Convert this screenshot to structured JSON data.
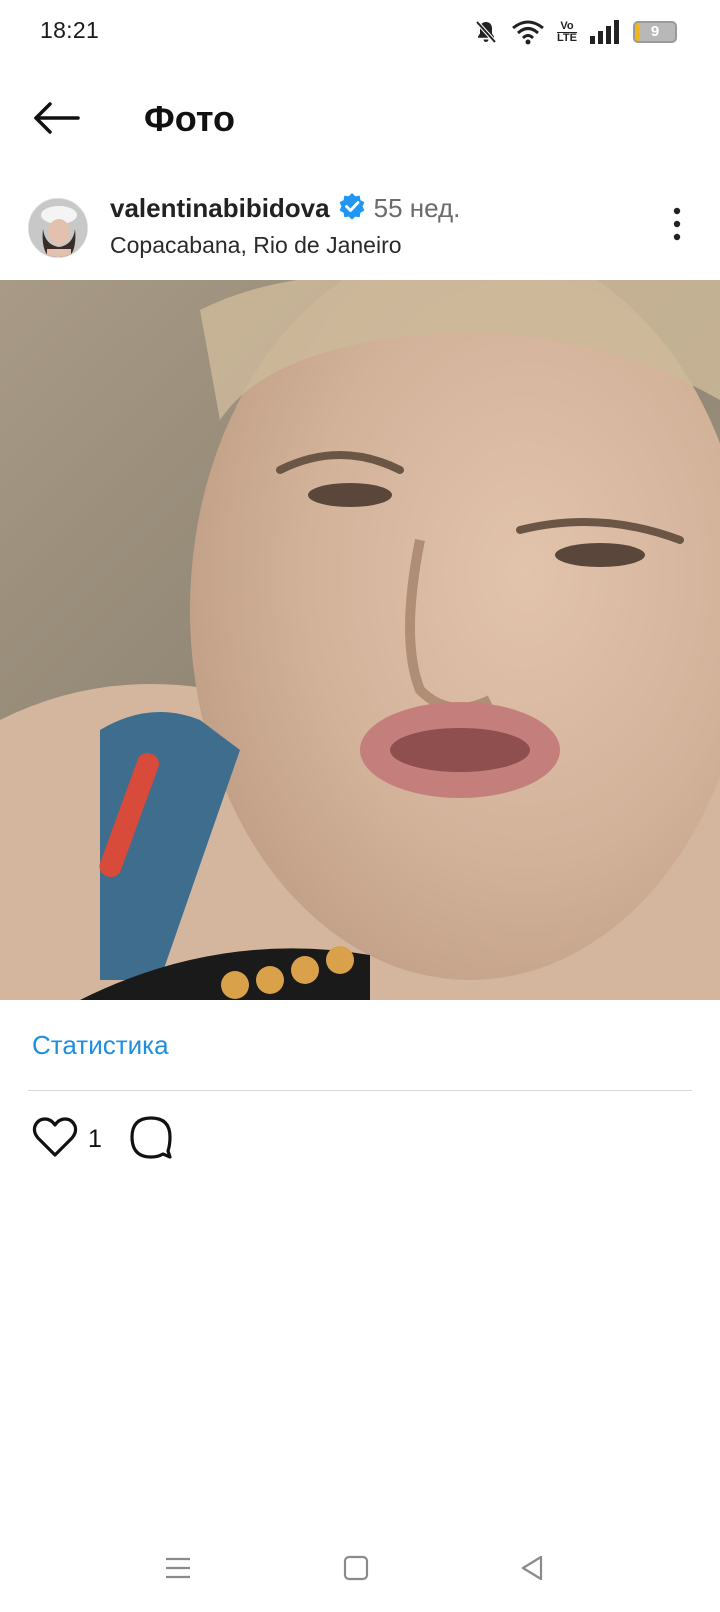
{
  "status_bar": {
    "time": "18:21",
    "battery_level": "9",
    "battery_percent": 9,
    "icons": [
      "notifications-muted-icon",
      "wifi-icon",
      "volte-icon",
      "signal-icon",
      "battery-icon"
    ],
    "volte_top": "Vo",
    "volte_bottom": "LTE"
  },
  "header": {
    "title": "Фото",
    "back_icon": "arrow-left-icon"
  },
  "post": {
    "username": "valentinabibidova",
    "verified": true,
    "time_ago": "55 нед.",
    "location": "Copacabana, Rio de Janeiro",
    "more_icon": "more-vertical-icon",
    "stats_label": "Статистика",
    "likes": "1",
    "like_icon": "heart-icon",
    "comment_icon": "comment-icon"
  },
  "colors": {
    "link": "#1e8fe0",
    "verified_badge": "#2196f3",
    "battery_low": "#f1b51c"
  },
  "nav_bar": {
    "icons": [
      "menu-icon",
      "home-square-icon",
      "back-triangle-icon"
    ]
  }
}
